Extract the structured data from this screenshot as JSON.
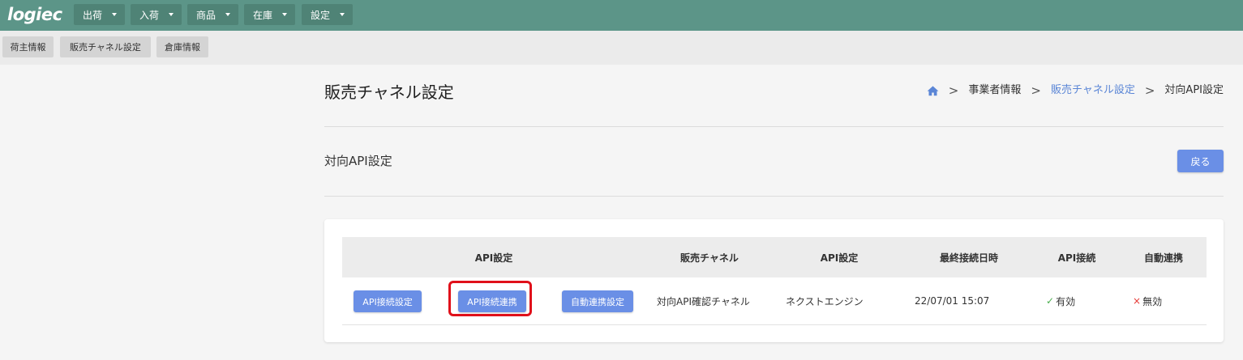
{
  "app": {
    "logo": "logiec"
  },
  "top_menu": [
    {
      "label": "出荷"
    },
    {
      "label": "入荷"
    },
    {
      "label": "商品"
    },
    {
      "label": "在庫"
    },
    {
      "label": "設定"
    }
  ],
  "sub_menu": [
    {
      "label": "荷主情報"
    },
    {
      "label": "販売チャネル設定"
    },
    {
      "label": "倉庫情報"
    }
  ],
  "page": {
    "title": "販売チャネル設定",
    "subtitle": "対向API設定",
    "back_label": "戻る"
  },
  "breadcrumb": {
    "home_icon": "home-icon",
    "items": [
      "事業者情報",
      "販売チャネル設定",
      "対向API設定"
    ],
    "separator": ">"
  },
  "table": {
    "headers": [
      "API設定",
      "販売チャネル",
      "API設定",
      "最終接続日時",
      "API接続",
      "自動連携"
    ],
    "rows": [
      {
        "buttons": [
          "API接続設定",
          "API接続連携",
          "自動連携設定"
        ],
        "channel": "対向API確認チャネル",
        "api_setting": "ネクストエンジン",
        "last_connected": "22/07/01 15:07",
        "api_connection": {
          "mark": "✓",
          "text": "有効"
        },
        "auto_link": {
          "mark": "×",
          "text": "無効"
        }
      }
    ]
  },
  "colors": {
    "topbar": "#5c9588",
    "primary": "#6a8fe6",
    "link": "#5b86d6",
    "highlight": "#e0101a"
  }
}
